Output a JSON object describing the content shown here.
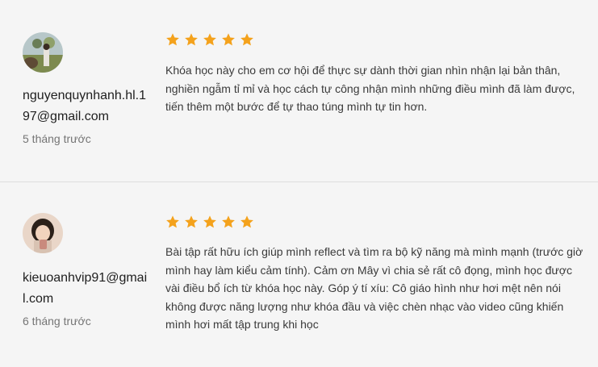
{
  "colors": {
    "star": "#f4a21c",
    "background": "#f5f5f5",
    "divider": "#dedede"
  },
  "reviews": [
    {
      "email": "nguyenquynhanh.hl.197@gmail.com",
      "time": "5 tháng trước",
      "rating": 5,
      "text": "Khóa học này cho em cơ hội để thực sự dành thời gian nhìn nhận lại bản thân, nghiền ngẫm tỉ mỉ và học cách tự công nhận mình những điều mình đã làm được, tiến thêm một bước để tự thao túng mình tự tin hơn."
    },
    {
      "email": "kieuoanhvip91@gmail.com",
      "time": "6 tháng trước",
      "rating": 5,
      "text": "Bài tập rất hữu ích giúp mình reflect và tìm ra bộ kỹ năng mà mình mạnh (trước giờ mình hay làm kiểu cảm tính). Cảm ơn Mây vì chia sẻ rất cô đọng, mình học được vài điều bổ ích từ khóa học này. Góp ý tí xíu: Cô giáo hình như hơi mệt nên nói không được năng lượng như khóa đầu và việc chèn nhạc vào video cũng khiến mình hơi mất tập trung khi học"
    }
  ]
}
